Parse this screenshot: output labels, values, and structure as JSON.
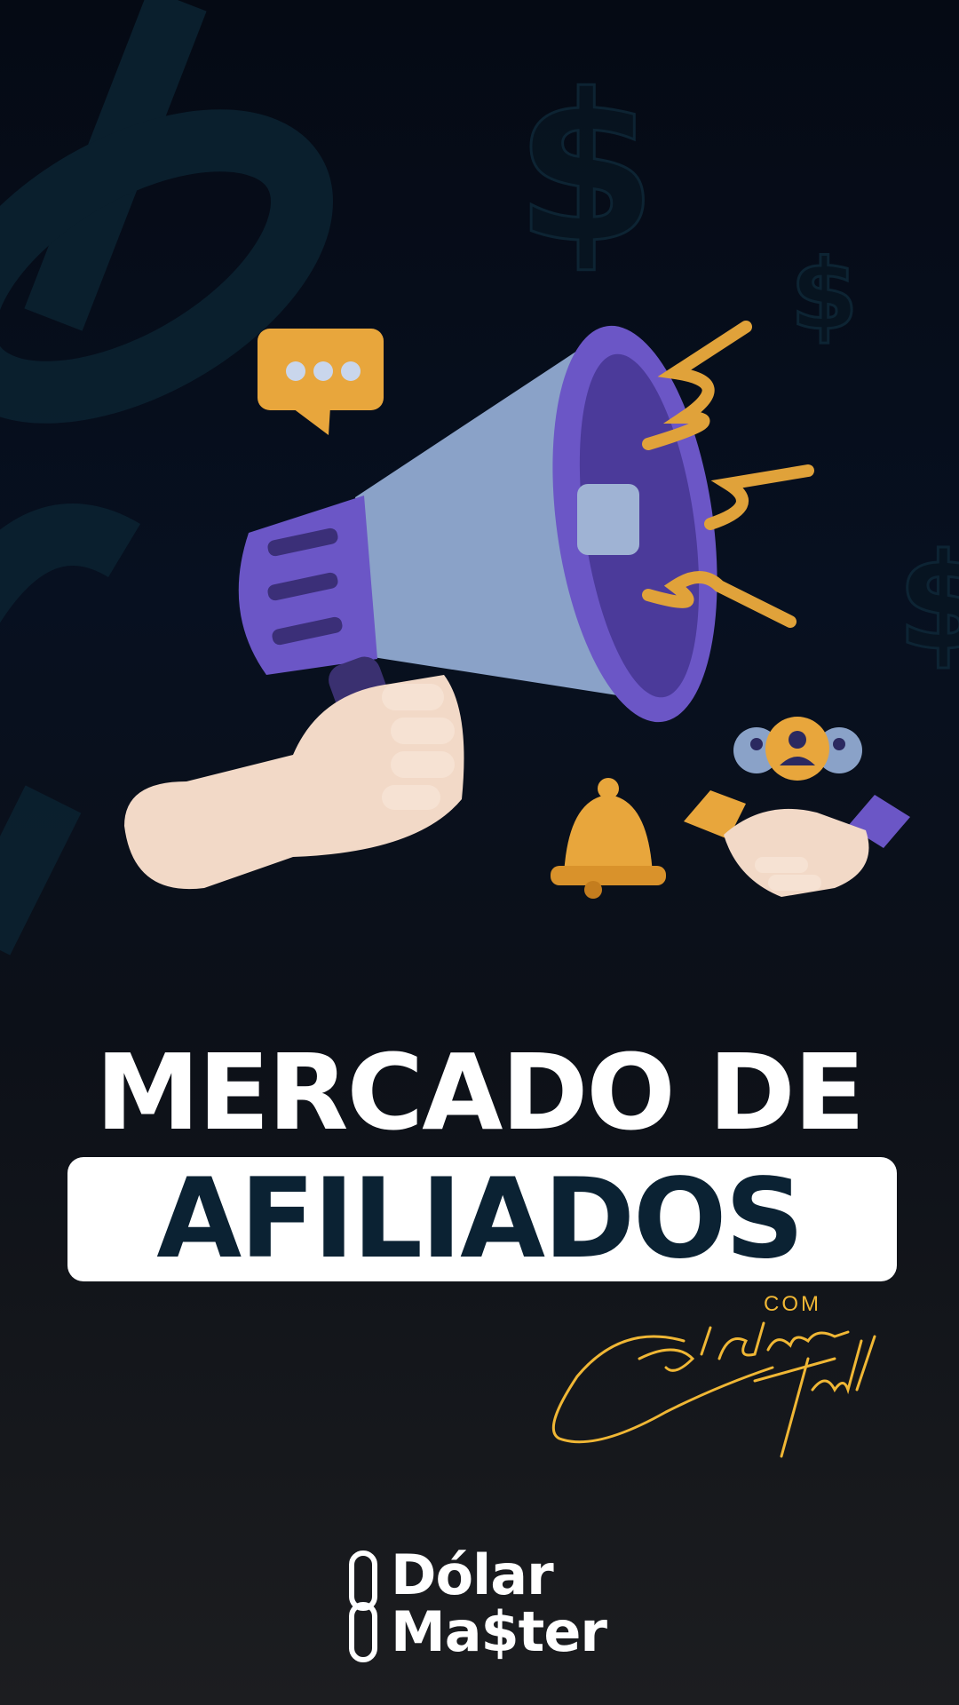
{
  "headline": {
    "line1": "MERCADO DE",
    "line2": "AFILIADOS"
  },
  "byline": {
    "prefix": "COM",
    "signature_text": "Carlinhos Troll"
  },
  "brand": {
    "line1": "Dólar",
    "line2": "Ma$ter"
  },
  "colors": {
    "background_top": "#050a14",
    "background_bottom": "#1c1d20",
    "accent_gold": "#f0b735",
    "headline_box": "#ffffff",
    "headline_dark_text": "#0b2233",
    "megaphone_purple": "#6b56c6",
    "megaphone_body": "#8aa2c8"
  },
  "icons": [
    "dollar-sign-icon",
    "chain-link-icon",
    "chat-bubble-icon",
    "megaphone-icon",
    "hand-icon",
    "bell-icon",
    "handshake-icon",
    "users-icon",
    "logo-chain-icon"
  ]
}
